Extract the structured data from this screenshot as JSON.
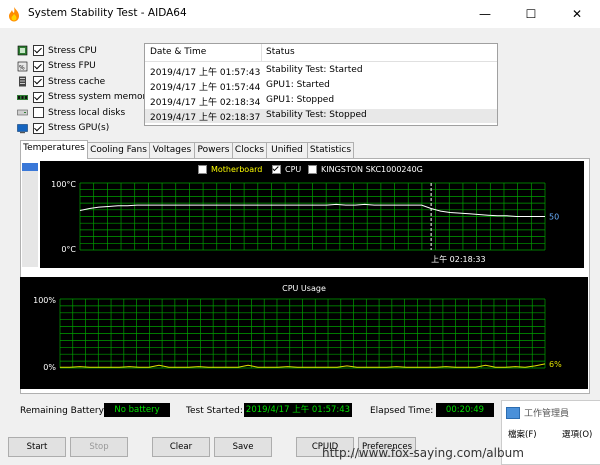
{
  "window": {
    "title": "System Stability Test - AIDA64",
    "minimize_glyph": "—",
    "maximize_glyph": "☐",
    "close_glyph": "✕"
  },
  "stress_options": [
    {
      "label": "Stress CPU",
      "checked": true,
      "icon": "cpu-icon"
    },
    {
      "label": "Stress FPU",
      "checked": true,
      "icon": "fpu-icon"
    },
    {
      "label": "Stress cache",
      "checked": true,
      "icon": "cache-icon"
    },
    {
      "label": "Stress system memory",
      "checked": true,
      "icon": "memory-icon"
    },
    {
      "label": "Stress local disks",
      "checked": false,
      "icon": "disk-icon"
    },
    {
      "label": "Stress GPU(s)",
      "checked": true,
      "icon": "gpu-icon"
    }
  ],
  "log": {
    "headers": [
      "Date & Time",
      "Status"
    ],
    "rows": [
      {
        "time": "2019/4/17 上午 01:57:43",
        "status": "Stability Test: Started"
      },
      {
        "time": "2019/4/17 上午 01:57:44",
        "status": "GPU1: Started"
      },
      {
        "time": "2019/4/17 上午 02:18:34",
        "status": "GPU1: Stopped"
      },
      {
        "time": "2019/4/17 上午 02:18:37",
        "status": "Stability Test: Stopped"
      }
    ]
  },
  "tabs": [
    "Temperatures",
    "Cooling Fans",
    "Voltages",
    "Powers",
    "Clocks",
    "Unified",
    "Statistics"
  ],
  "temperature_chart": {
    "legend": [
      {
        "label": "Motherboard",
        "checked": false,
        "color": "#ffff00"
      },
      {
        "label": "CPU",
        "checked": true,
        "color": "#ffffff"
      },
      {
        "label": "KINGSTON SKC1000240G",
        "checked": false,
        "color": "#ffffff"
      }
    ],
    "y_max_label": "100°C",
    "y_min_label": "0°C",
    "marker_label": "上午 02:18:33",
    "current_value": "50",
    "grid_color": "#00a000"
  },
  "cpu_usage_chart": {
    "title": "CPU Usage",
    "y_max_label": "100%",
    "y_min_label": "0%",
    "current_value": "6%",
    "grid_color": "#00a000",
    "line_color": "#e0e000"
  },
  "chart_data": [
    {
      "type": "line",
      "title": "",
      "ylabel": "°C",
      "ylim": [
        0,
        100
      ],
      "series": [
        {
          "name": "CPU",
          "values": [
            59,
            62,
            64,
            65,
            66,
            66,
            67,
            67,
            67,
            67,
            67,
            67,
            67,
            67,
            67,
            67,
            67,
            67,
            67,
            67,
            67,
            67,
            67,
            67,
            67,
            67,
            67,
            68,
            67,
            67,
            68,
            67,
            67,
            67,
            67,
            67,
            67,
            62,
            58,
            56,
            55,
            54,
            53,
            52,
            51,
            51,
            50,
            50,
            50,
            50
          ]
        }
      ]
    },
    {
      "type": "line",
      "title": "CPU Usage",
      "ylabel": "%",
      "ylim": [
        0,
        100
      ],
      "series": [
        {
          "name": "CPU Usage",
          "values": [
            1,
            1,
            2,
            1,
            1,
            1,
            1,
            2,
            1,
            1,
            4,
            1,
            1,
            1,
            2,
            1,
            1,
            1,
            1,
            4,
            1,
            1,
            1,
            2,
            1,
            1,
            1,
            1,
            1,
            3,
            1,
            1,
            1,
            1,
            2,
            1,
            1,
            1,
            1,
            2,
            1,
            1,
            1,
            4,
            1,
            1,
            2,
            1,
            3,
            6
          ]
        }
      ]
    }
  ],
  "status": {
    "remaining_battery_label": "Remaining Battery:",
    "remaining_battery_value": "No battery",
    "test_started_label": "Test Started:",
    "test_started_value": "2019/4/17 上午 01:57:43",
    "elapsed_label": "Elapsed Time:",
    "elapsed_value": "00:20:49"
  },
  "buttons": {
    "start": "Start",
    "stop": "Stop",
    "clear": "Clear",
    "save": "Save",
    "cpuid": "CPUID",
    "preferences": "Preferences"
  },
  "task_manager": {
    "title": "工作管理員",
    "menu_file": "檔案(F)",
    "menu_options": "選項(O)"
  },
  "watermark": "http://www.fox-saying.com/album"
}
